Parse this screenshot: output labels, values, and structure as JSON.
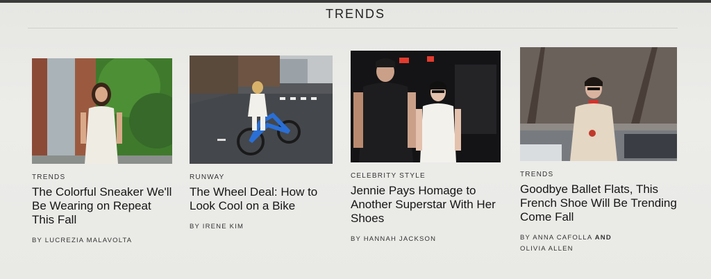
{
  "section": {
    "title": "TRENDS"
  },
  "articles": [
    {
      "category": "TRENDS",
      "headline": "The Colorful Sneaker We'll Be Wearing on Repeat This Fall",
      "byline": "BY LUCREZIA MALAVOLTA"
    },
    {
      "category": "RUNWAY",
      "headline": "The Wheel Deal: How to Look Cool on a Bike",
      "byline": "BY IRENE KIM"
    },
    {
      "category": "CELEBRITY STYLE",
      "headline": "Jennie Pays Homage to Another Superstar With Her Shoes",
      "byline": "BY HANNAH JACKSON"
    },
    {
      "category": "TRENDS",
      "headline": "Goodbye Ballet Flats, This French Shoe Will Be Trending Come Fall",
      "byline_prefix": "BY ANNA CAFOLLA",
      "byline_and": "AND",
      "byline_second": "OLIVIA ALLEN"
    }
  ]
}
